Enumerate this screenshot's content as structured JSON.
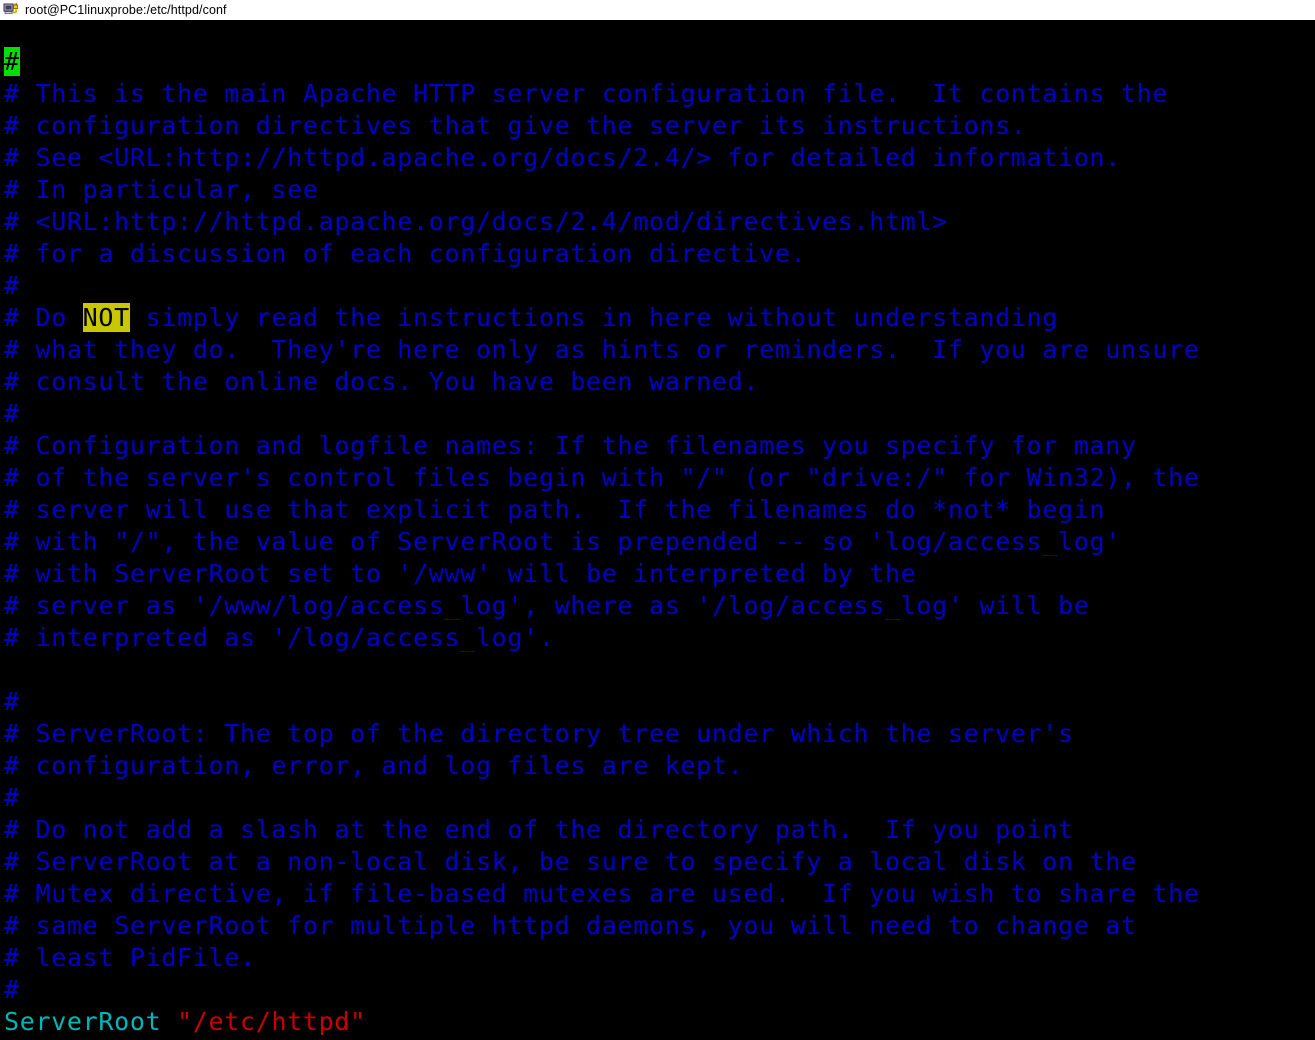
{
  "window": {
    "title": "root@PC1linuxprobe:/etc/httpd/conf",
    "icon": "putty-terminal-icon"
  },
  "colors": {
    "background": "#000000",
    "comment": "#0000c8",
    "keyword": "#00b6b6",
    "string": "#c80000",
    "cursor_bg": "#00e000",
    "cursor_fg": "#000000",
    "search_highlight_bg": "#c8c800",
    "search_highlight_fg": "#000000",
    "titlebar_bg": "#ffffff",
    "titlebar_fg": "#000000"
  },
  "terminal": {
    "cursor": {
      "char": "#",
      "line": 1,
      "column": 1
    },
    "search_match": "NOT",
    "lines": [
      {
        "segments": [
          {
            "text": "#",
            "style": "cursor"
          }
        ]
      },
      {
        "segments": [
          {
            "text": "# This is the main Apache HTTP server configuration file.  It contains the",
            "style": "comment"
          }
        ]
      },
      {
        "segments": [
          {
            "text": "# configuration directives that give the server its instructions.",
            "style": "comment"
          }
        ]
      },
      {
        "segments": [
          {
            "text": "# See <URL:http://httpd.apache.org/docs/2.4/> for detailed information.",
            "style": "comment"
          }
        ]
      },
      {
        "segments": [
          {
            "text": "# In particular, see",
            "style": "comment"
          }
        ]
      },
      {
        "segments": [
          {
            "text": "# <URL:http://httpd.apache.org/docs/2.4/mod/directives.html>",
            "style": "comment"
          }
        ]
      },
      {
        "segments": [
          {
            "text": "# for a discussion of each configuration directive.",
            "style": "comment"
          }
        ]
      },
      {
        "segments": [
          {
            "text": "#",
            "style": "comment"
          }
        ]
      },
      {
        "segments": [
          {
            "text": "# Do ",
            "style": "comment"
          },
          {
            "text": "NOT",
            "style": "search"
          },
          {
            "text": " simply read the instructions in here without understanding",
            "style": "comment"
          }
        ]
      },
      {
        "segments": [
          {
            "text": "# what they do.  They're here only as hints or reminders.  If you are unsure",
            "style": "comment"
          }
        ]
      },
      {
        "segments": [
          {
            "text": "# consult the online docs. You have been warned.",
            "style": "comment"
          }
        ]
      },
      {
        "segments": [
          {
            "text": "#",
            "style": "comment"
          }
        ]
      },
      {
        "segments": [
          {
            "text": "# Configuration and logfile names: If the filenames you specify for many",
            "style": "comment"
          }
        ]
      },
      {
        "segments": [
          {
            "text": "# of the server's control files begin with \"/\" (or \"drive:/\" for Win32), the",
            "style": "comment"
          }
        ]
      },
      {
        "segments": [
          {
            "text": "# server will use that explicit path.  If the filenames do *not* begin",
            "style": "comment"
          }
        ]
      },
      {
        "segments": [
          {
            "text": "# with \"/\", the value of ServerRoot is prepended -- so 'log/access_log'",
            "style": "comment"
          }
        ]
      },
      {
        "segments": [
          {
            "text": "# with ServerRoot set to '/www' will be interpreted by the",
            "style": "comment"
          }
        ]
      },
      {
        "segments": [
          {
            "text": "# server as '/www/log/access_log', where as '/log/access_log' will be",
            "style": "comment"
          }
        ]
      },
      {
        "segments": [
          {
            "text": "# interpreted as '/log/access_log'.",
            "style": "comment"
          }
        ]
      },
      {
        "segments": [
          {
            "text": "",
            "style": "comment"
          }
        ]
      },
      {
        "segments": [
          {
            "text": "#",
            "style": "comment"
          }
        ]
      },
      {
        "segments": [
          {
            "text": "# ServerRoot: The top of the directory tree under which the server's",
            "style": "comment"
          }
        ]
      },
      {
        "segments": [
          {
            "text": "# configuration, error, and log files are kept.",
            "style": "comment"
          }
        ]
      },
      {
        "segments": [
          {
            "text": "#",
            "style": "comment"
          }
        ]
      },
      {
        "segments": [
          {
            "text": "# Do not add a slash at the end of the directory path.  If you point",
            "style": "comment"
          }
        ]
      },
      {
        "segments": [
          {
            "text": "# ServerRoot at a non-local disk, be sure to specify a local disk on the",
            "style": "comment"
          }
        ]
      },
      {
        "segments": [
          {
            "text": "# Mutex directive, if file-based mutexes are used.  If you wish to share the",
            "style": "comment"
          }
        ]
      },
      {
        "segments": [
          {
            "text": "# same ServerRoot for multiple httpd daemons, you will need to change at",
            "style": "comment"
          }
        ]
      },
      {
        "segments": [
          {
            "text": "# least PidFile.",
            "style": "comment"
          }
        ]
      },
      {
        "segments": [
          {
            "text": "#",
            "style": "comment"
          }
        ]
      },
      {
        "segments": [
          {
            "text": "ServerRoot",
            "style": "keyword"
          },
          {
            "text": " ",
            "style": "comment"
          },
          {
            "text": "\"/etc/httpd\"",
            "style": "string"
          }
        ]
      }
    ]
  }
}
